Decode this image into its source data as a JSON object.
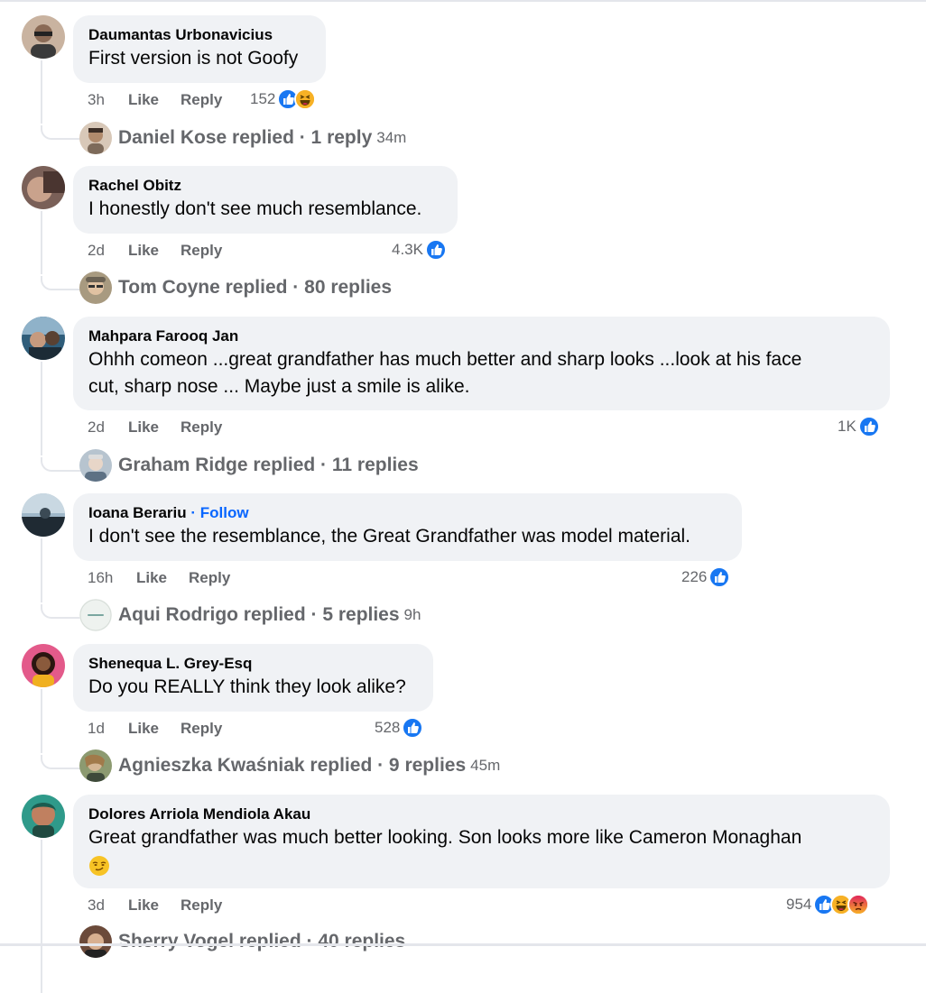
{
  "comments": [
    {
      "author": "Daumantas Urbonavicius",
      "text": "First version is not Goofy",
      "time": "3h",
      "like_label": "Like",
      "reply_label": "Reply",
      "reaction_count": "152",
      "reactions": [
        "like",
        "haha"
      ],
      "reply_summary": "Daniel Kose replied · 1 reply",
      "reply_time": "34m"
    },
    {
      "author": "Rachel Obitz",
      "text": "I honestly don't see much resemblance.",
      "time": "2d",
      "like_label": "Like",
      "reply_label": "Reply",
      "reaction_count": "4.3K",
      "reactions": [
        "like"
      ],
      "reply_summary": "Tom Coyne replied · 80 replies",
      "reply_time": ""
    },
    {
      "author": "Mahpara Farooq Jan",
      "text_line1": "Ohhh comeon ...great grandfather has much better and sharp looks ...look at his face",
      "text_line2": "cut, sharp nose ... Maybe just a smile is alike.",
      "time": "2d",
      "like_label": "Like",
      "reply_label": "Reply",
      "reaction_count": "1K",
      "reactions": [
        "like"
      ],
      "reply_summary": "Graham Ridge replied · 11 replies",
      "reply_time": ""
    },
    {
      "author": "Ioana Berariu",
      "follow_label": "· Follow",
      "text": "I don't see the resemblance, the Great Grandfather was model material.",
      "time": "16h",
      "like_label": "Like",
      "reply_label": "Reply",
      "reaction_count": "226",
      "reactions": [
        "like"
      ],
      "reply_summary": "Aqui Rodrigo replied · 5 replies",
      "reply_time": "9h"
    },
    {
      "author": "Shenequa L. Grey-Esq",
      "text": "Do you REALLY think they look alike?",
      "time": "1d",
      "like_label": "Like",
      "reply_label": "Reply",
      "reaction_count": "528",
      "reactions": [
        "like"
      ],
      "reply_summary": "Agnieszka Kwaśniak replied · 9 replies",
      "reply_time": "45m"
    },
    {
      "author": "Dolores Arriola Mendiola Akau",
      "text": "Great grandfather was much better looking. Son looks more like Cameron Monaghan",
      "time": "3d",
      "like_label": "Like",
      "reply_label": "Reply",
      "reaction_count": "954",
      "reactions": [
        "like",
        "haha",
        "angry"
      ],
      "reply_summary": "Sherry Vogel replied · 40 replies",
      "reply_time": ""
    }
  ],
  "colors": {
    "bubble": "#f0f2f5",
    "secondary_text": "#65676b",
    "like_blue": "#1877f2",
    "follow_blue": "#0866ff"
  }
}
